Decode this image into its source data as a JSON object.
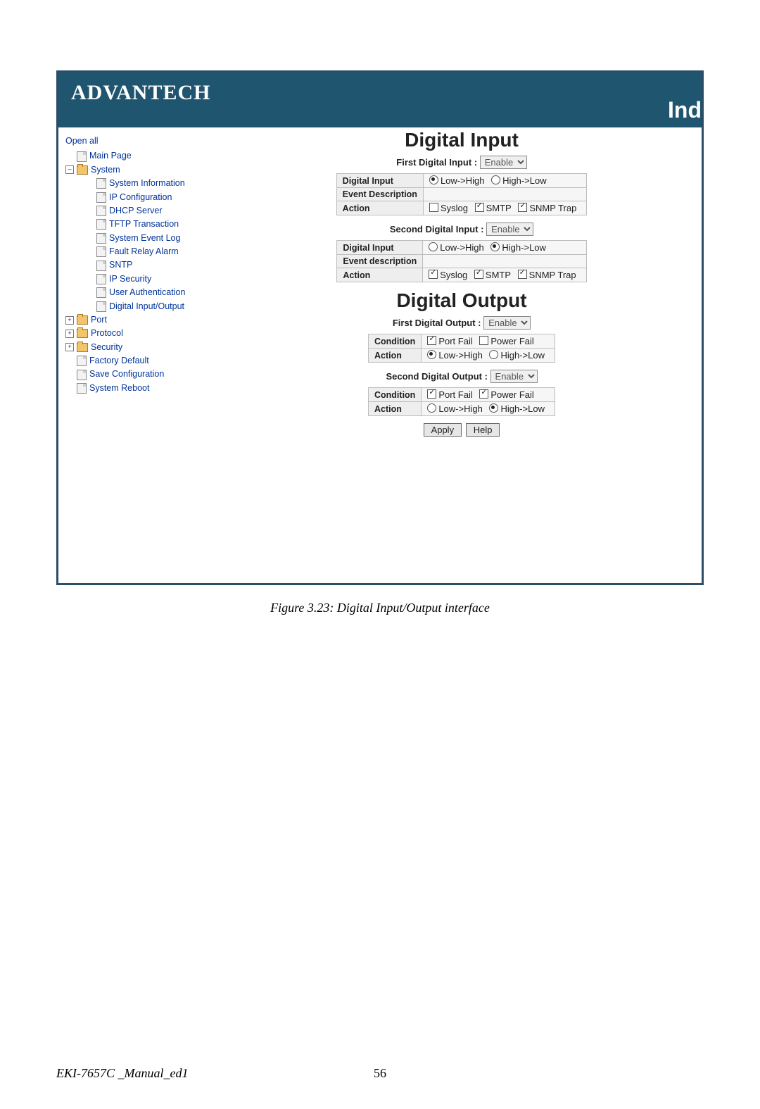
{
  "brand": {
    "logo": "ADVANTECH",
    "right": "Ind"
  },
  "sidebar": {
    "open_all": "Open all",
    "main_page": "Main Page",
    "system": "System",
    "system_items": [
      "System Information",
      "IP Configuration",
      "DHCP Server",
      "TFTP Transaction",
      "System Event Log",
      "Fault Relay Alarm",
      "SNTP",
      "IP Security",
      "User Authentication",
      "Digital Input/Output"
    ],
    "port": "Port",
    "protocol": "Protocol",
    "security": "Security",
    "factory_default": "Factory Default",
    "save_config": "Save Configuration",
    "system_reboot": "System Reboot"
  },
  "headings": {
    "digital_input": "Digital Input",
    "digital_output": "Digital Output"
  },
  "labels": {
    "first_di": "First Digital Input :",
    "second_di": "Second Digital Input :",
    "first_do": "First Digital Output :",
    "second_do": "Second Digital Output :",
    "enable": "Enable",
    "digital_input": "Digital Input",
    "event_desc_caps": "Event Description",
    "event_desc_lower": "Event description",
    "action": "Action",
    "condition": "Condition",
    "low_high": "Low->High",
    "high_low": "High->Low",
    "syslog": "Syslog",
    "smtp": "SMTP",
    "snmp_trap": "SNMP Trap",
    "port_fail": "Port Fail",
    "power_fail": "Power Fail",
    "apply": "Apply",
    "help": "Help"
  },
  "state": {
    "di1": {
      "dir_lowhigh": true,
      "syslog": false,
      "smtp": true,
      "snmp": true,
      "event": ""
    },
    "di2": {
      "dir_lowhigh": false,
      "syslog": true,
      "smtp": true,
      "snmp": true,
      "event": ""
    },
    "do1": {
      "port_fail": true,
      "power_fail": false,
      "act_lowhigh": true
    },
    "do2": {
      "port_fail": true,
      "power_fail": true,
      "act_lowhigh": false
    }
  },
  "caption": "Figure 3.23: Digital Input/Output interface",
  "footer": {
    "doc": "EKI-7657C _Manual_ed1",
    "page": "56"
  }
}
